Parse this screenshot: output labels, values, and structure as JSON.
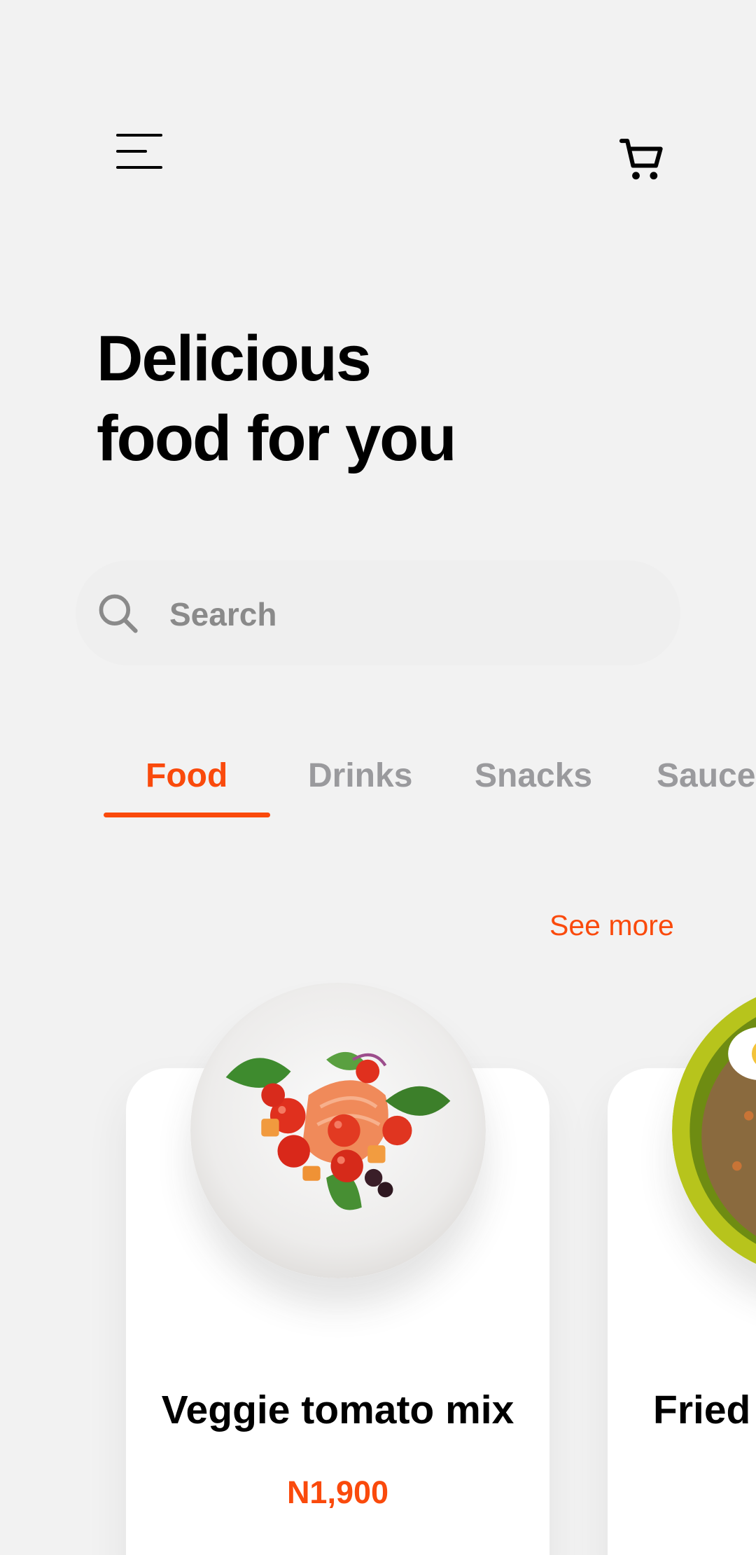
{
  "header": {
    "menu_icon": "hamburger-menu-icon",
    "cart_icon": "cart-icon"
  },
  "title": {
    "line1": "Delicious",
    "line2": "food for you"
  },
  "search": {
    "placeholder": "Search",
    "icon": "search-icon"
  },
  "tabs": [
    {
      "label": "Food",
      "active": true
    },
    {
      "label": "Drinks",
      "active": false
    },
    {
      "label": "Snacks",
      "active": false
    },
    {
      "label": "Sauce",
      "active": false
    }
  ],
  "see_more": "See more",
  "products": [
    {
      "name": "Veggie tomato mix",
      "price": "N1,900"
    },
    {
      "name": "Fried",
      "price": ""
    }
  ],
  "colors": {
    "accent": "#FA4A0C",
    "background": "#F2F2F2",
    "card": "#FFFFFF",
    "inactive_tab": "#9A9A9D"
  }
}
